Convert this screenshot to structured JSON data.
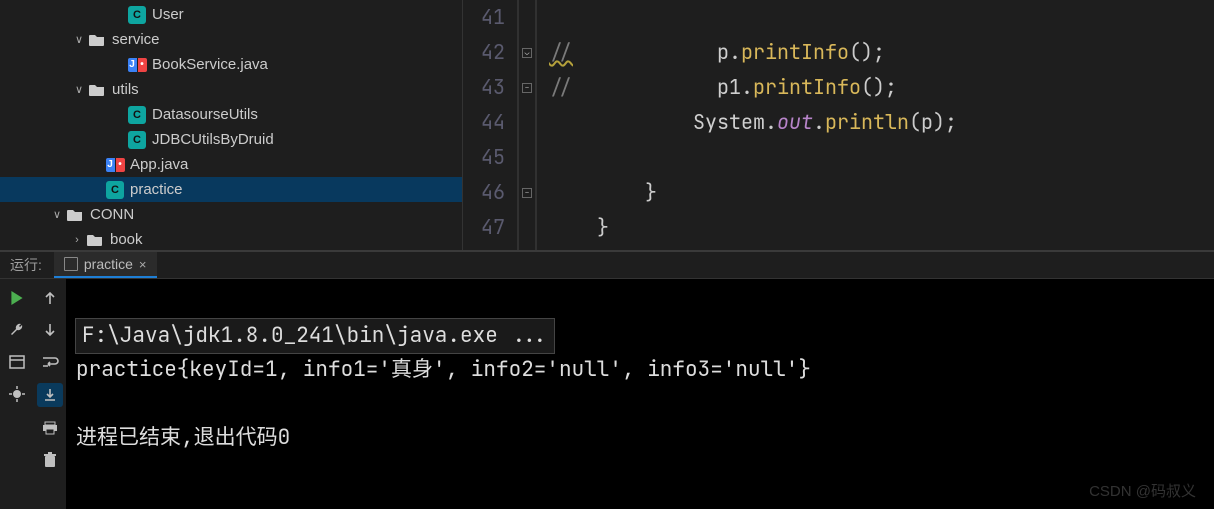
{
  "sidebar": {
    "items": [
      {
        "indent": 110,
        "chevron": "",
        "iconType": "c",
        "iconText": "C",
        "label": "User"
      },
      {
        "indent": 70,
        "chevron": "∨",
        "iconType": "folder",
        "iconText": "",
        "label": "service"
      },
      {
        "indent": 110,
        "chevron": "",
        "iconType": "java",
        "iconText": "",
        "label": "BookService.java"
      },
      {
        "indent": 70,
        "chevron": "∨",
        "iconType": "folder",
        "iconText": "",
        "label": "utils"
      },
      {
        "indent": 110,
        "chevron": "",
        "iconType": "c",
        "iconText": "C",
        "label": "DatasourseUtils"
      },
      {
        "indent": 110,
        "chevron": "",
        "iconType": "c",
        "iconText": "C",
        "label": "JDBCUtilsByDruid"
      },
      {
        "indent": 88,
        "chevron": "",
        "iconType": "java",
        "iconText": "",
        "label": "App.java"
      },
      {
        "indent": 88,
        "chevron": "",
        "iconType": "c",
        "iconText": "C",
        "label": "practice",
        "selected": true
      },
      {
        "indent": 48,
        "chevron": "∨",
        "iconType": "folder",
        "iconText": "",
        "label": "CONN"
      },
      {
        "indent": 68,
        "chevron": ">",
        "iconType": "folder",
        "iconText": "",
        "label": "book"
      }
    ]
  },
  "editor": {
    "lines": [
      {
        "n": "41",
        "html": ""
      },
      {
        "n": "42",
        "html": "<span class='tok-comment tok-squiggle'>//</span>            <span class='tok-ident'>p</span><span class='tok-dot'>.</span><span class='tok-call'>printInfo</span><span class='tok-paren'>();</span>",
        "fold": "down"
      },
      {
        "n": "43",
        "html": "<span class='tok-comment'>//</span>            <span class='tok-ident'>p1</span><span class='tok-dot'>.</span><span class='tok-call'>printInfo</span><span class='tok-paren'>();</span>",
        "fold": "up"
      },
      {
        "n": "44",
        "html": "            <span class='tok-sys'>System</span><span class='tok-dot'>.</span><span class='tok-field'>out</span><span class='tok-dot'>.</span><span class='tok-call'>println</span><span class='tok-paren'>(</span><span class='tok-ident'>p</span><span class='tok-paren'>);</span>"
      },
      {
        "n": "45",
        "html": ""
      },
      {
        "n": "46",
        "html": "        <span class='tok-brace'>}</span>",
        "fold": "up"
      },
      {
        "n": "47",
        "html": "    <span class='tok-brace'>}</span>"
      }
    ]
  },
  "run": {
    "header_label": "运行:",
    "tab_label": "practice",
    "close_glyph": "×",
    "console_line1": "F:\\Java\\jdk1.8.0_241\\bin\\java.exe ...",
    "console_line2": "practice{keyId=1, info1='真身', info2='null', info3='null'}",
    "console_blank": "",
    "console_line3": "进程已结束,退出代码0"
  },
  "watermark": "CSDN @码叔义"
}
